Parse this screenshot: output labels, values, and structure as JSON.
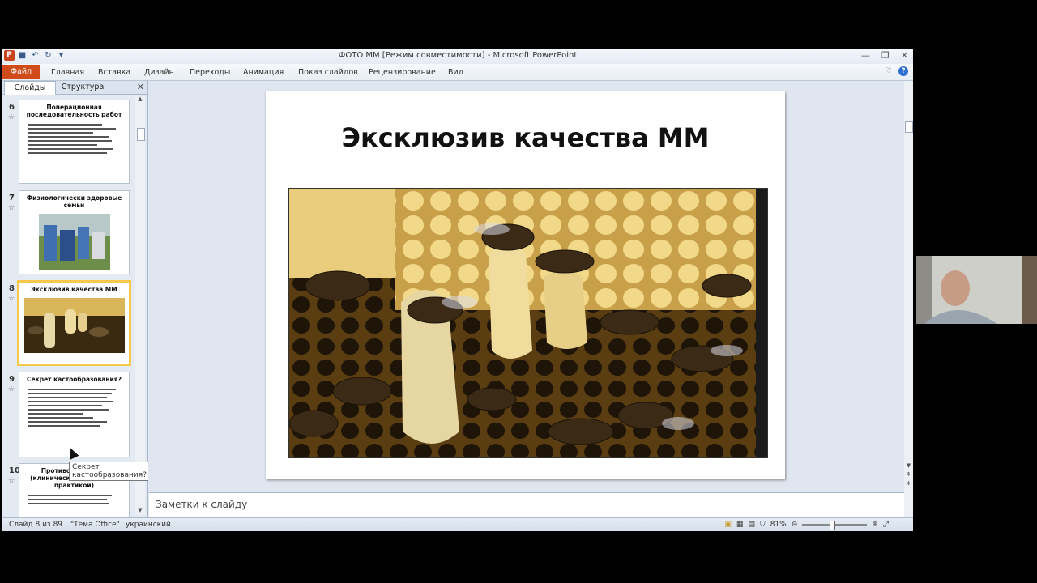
{
  "window": {
    "title": "ФОТО  ММ [Режим совместимости]  -  Microsoft PowerPoint"
  },
  "ribbon": {
    "file_tab": "Файл",
    "tabs": [
      "Главная",
      "Вставка",
      "Дизайн",
      "Переходы",
      "Анимация",
      "Показ слайдов",
      "Рецензирование",
      "Вид"
    ]
  },
  "panel": {
    "tabs": [
      "Слайды",
      "Структура"
    ],
    "slides": [
      {
        "num": "6",
        "title": "Поперационная последовательность работ"
      },
      {
        "num": "7",
        "title": "Физиологически здоровые семьи"
      },
      {
        "num": "8",
        "title": "Эксклюзив качества ММ"
      },
      {
        "num": "9",
        "title": "Секрет кастообразования?"
      },
      {
        "num": "10",
        "title": "Противопоказания (клинические испытания практикой)"
      }
    ],
    "tooltip": "Секрет кастообразования?"
  },
  "slide": {
    "title": "Эксклюзив качества ММ"
  },
  "notes": {
    "placeholder": "Заметки к слайду"
  },
  "status": {
    "slide_info": "Слайд 8 из 89",
    "theme": "\"Тема Office\"",
    "language": "украинский",
    "zoom": "81%"
  },
  "colors": {
    "file_tab": "#d04a1a",
    "selection": "#f6c94a"
  }
}
